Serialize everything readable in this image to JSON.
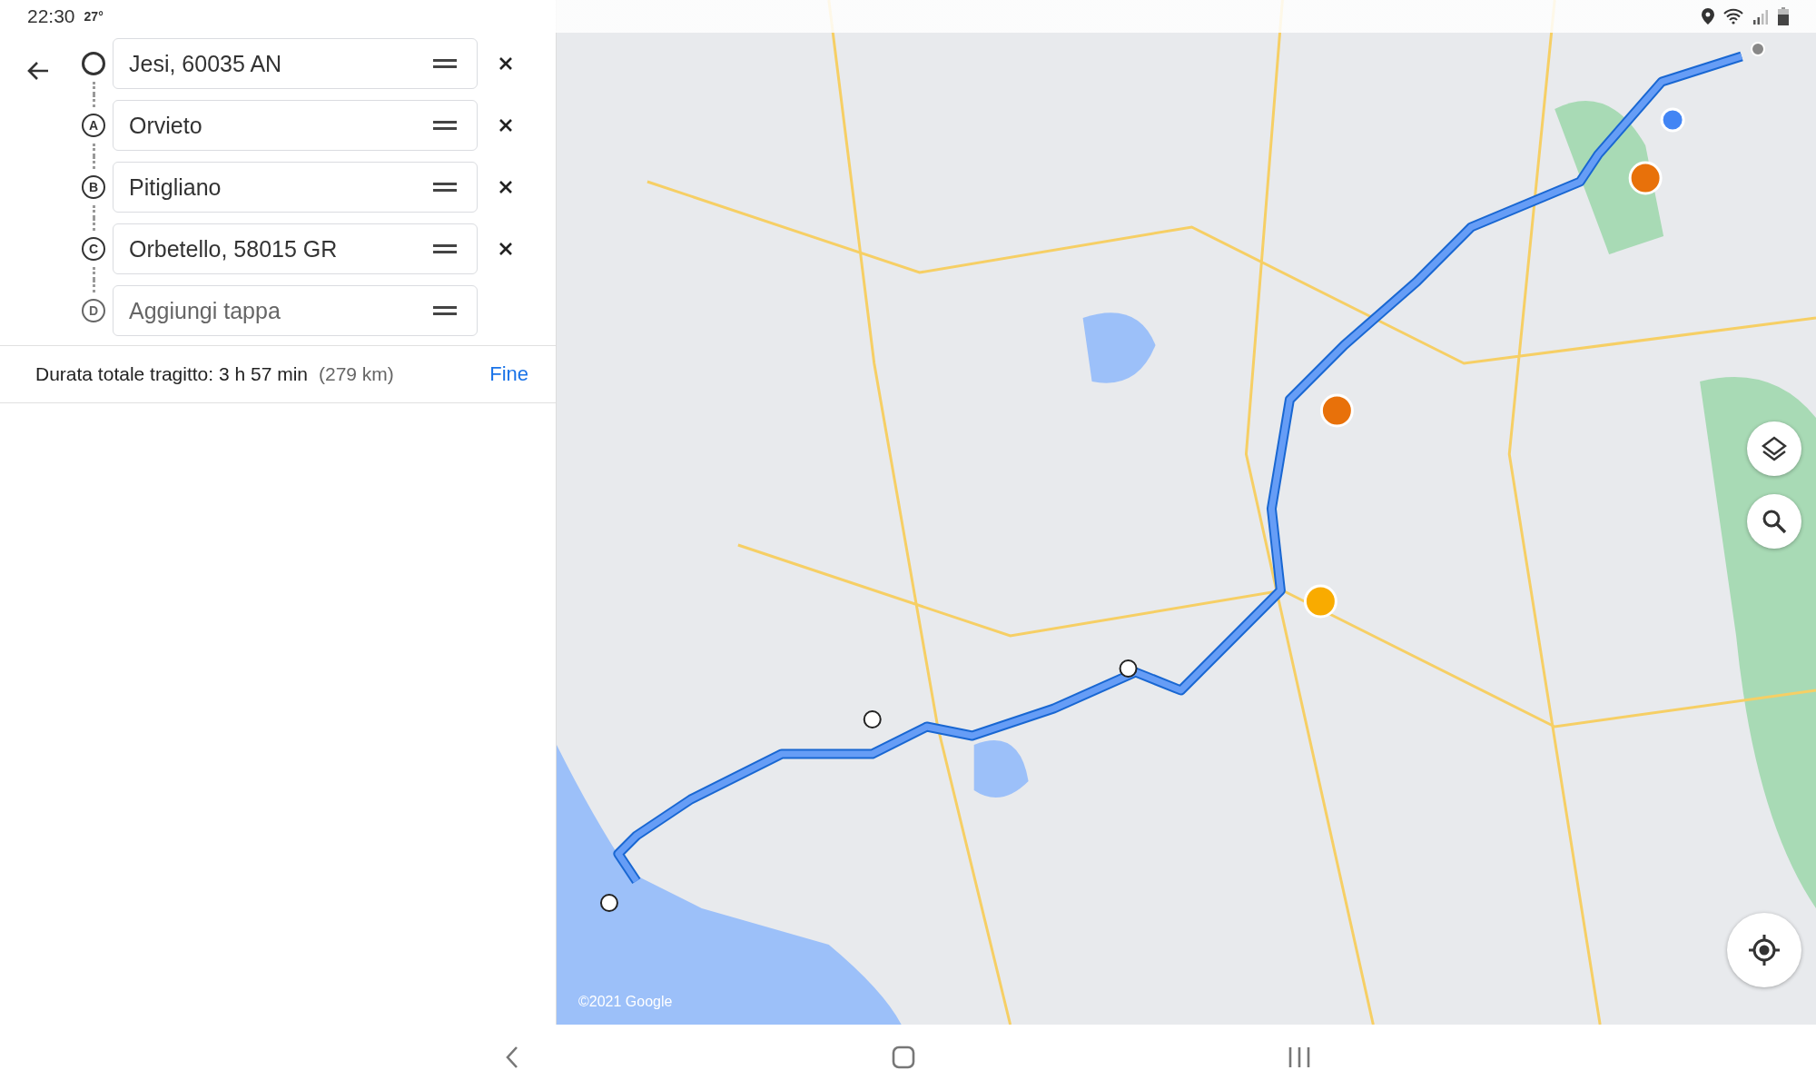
{
  "status_bar": {
    "time": "22:30",
    "temperature": "27°"
  },
  "stops": [
    {
      "kind": "origin",
      "value": "Jesi, 60035 AN",
      "removable": true
    },
    {
      "kind": "waypoint",
      "marker": "A",
      "value": "Orvieto",
      "removable": true
    },
    {
      "kind": "waypoint",
      "marker": "B",
      "value": "Pitigliano",
      "removable": true
    },
    {
      "kind": "waypoint",
      "marker": "C",
      "value": "Orbetello, 58015 GR",
      "removable": true
    },
    {
      "kind": "empty",
      "marker": "D",
      "placeholder": "Aggiungi tappa",
      "removable": false
    }
  ],
  "summary": {
    "duration": "Durata totale tragitto: 3 h 57 min",
    "distance": "(279 km)",
    "done": "Fine"
  },
  "map": {
    "copyright": "©2021 Google"
  }
}
